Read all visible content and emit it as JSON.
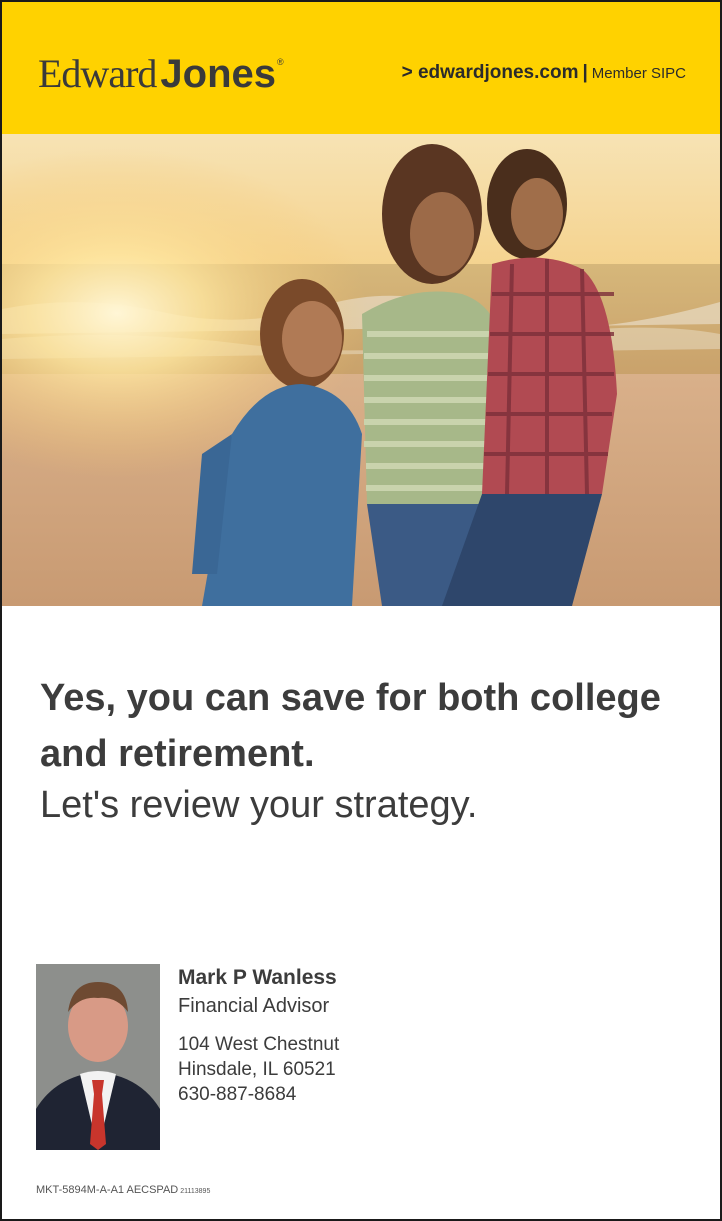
{
  "header": {
    "logo_first": "Edward",
    "logo_last": "Jones",
    "logo_reg": "®",
    "site_link": "> edwardjones.com",
    "separator": "|",
    "member": "Member SIPC",
    "background_color": "#ffd200"
  },
  "hero": {
    "image_icon": "beach-family-photo"
  },
  "headline": {
    "line1": "Yes, you can save for both college and retirement.",
    "subhead": "Let's review your strategy."
  },
  "advisor": {
    "name": "Mark P Wanless",
    "title": "Financial Advisor",
    "address1": "104 West Chestnut",
    "address2": "Hinsdale, IL 60521",
    "phone": "630-887-8684",
    "photo_icon": "advisor-portrait"
  },
  "footer": {
    "code": "MKT-5894M-A-A1 AECSPAD",
    "small_code": "21113895"
  }
}
